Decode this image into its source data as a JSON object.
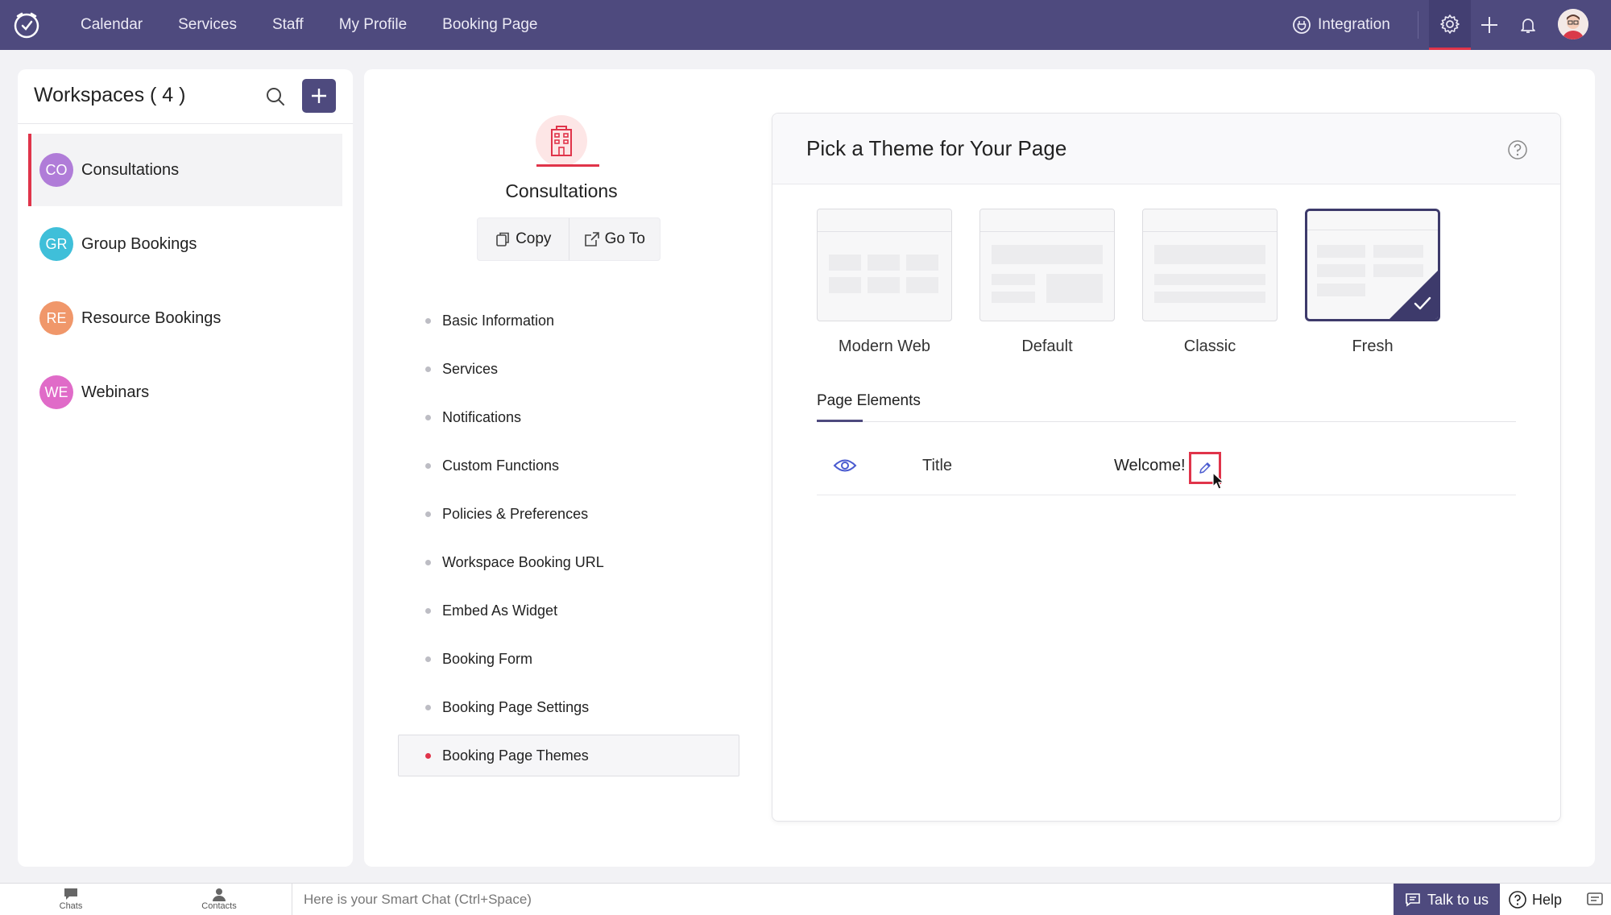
{
  "topbar": {
    "nav": [
      "Calendar",
      "Services",
      "Staff",
      "My Profile",
      "Booking Page"
    ],
    "integration_label": "Integration"
  },
  "workspaces": {
    "title": "Workspaces ( 4 )",
    "items": [
      {
        "initials": "CO",
        "name": "Consultations",
        "color": "#b07cd8"
      },
      {
        "initials": "GR",
        "name": "Group Bookings",
        "color": "#3fbfd9"
      },
      {
        "initials": "RE",
        "name": "Resource Bookings",
        "color": "#f0976a"
      },
      {
        "initials": "WE",
        "name": "Webinars",
        "color": "#e06bc8"
      }
    ]
  },
  "main": {
    "workspace_name": "Consultations",
    "copy_label": "Copy",
    "goto_label": "Go To",
    "menu": [
      "Basic Information",
      "Services",
      "Notifications",
      "Custom Functions",
      "Policies & Preferences",
      "Workspace Booking URL",
      "Embed As Widget",
      "Booking Form",
      "Booking Page Settings",
      "Booking Page Themes"
    ],
    "active_menu": "Booking Page Themes"
  },
  "themes": {
    "title": "Pick a Theme for Your Page",
    "options": [
      "Modern Web",
      "Default",
      "Classic",
      "Fresh"
    ],
    "selected": "Fresh",
    "page_elements_tab": "Page Elements",
    "element_row": {
      "name": "Title",
      "value": "Welcome!"
    }
  },
  "bottombar": {
    "chats": "Chats",
    "contacts": "Contacts",
    "smartchat_placeholder": "Here is your Smart Chat (Ctrl+Space)",
    "talk_label": "Talk to us",
    "help_label": "Help"
  },
  "colors": {
    "accent": "#4e4a7e",
    "highlight": "#e0344a"
  }
}
